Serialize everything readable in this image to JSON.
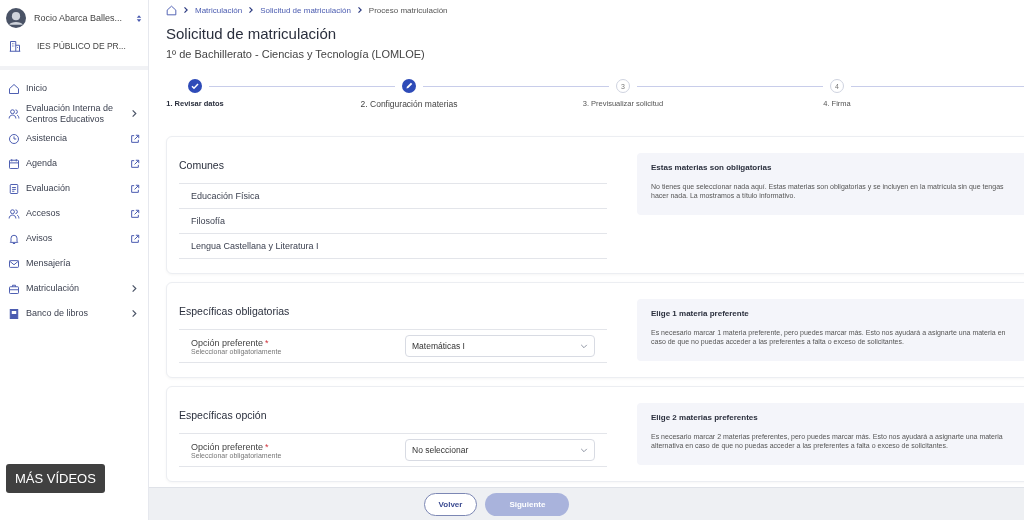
{
  "sidebar": {
    "user": {
      "name": "Rocio Abarca Balles..."
    },
    "school": {
      "name": "IES PÚBLICO DE PR..."
    },
    "items": [
      {
        "label": "Inicio",
        "kind": "link"
      },
      {
        "label": "Evaluación Interna de Centros Educativos",
        "kind": "submenu"
      },
      {
        "label": "Asistencia",
        "kind": "external"
      },
      {
        "label": "Agenda",
        "kind": "external"
      },
      {
        "label": "Evaluación",
        "kind": "external"
      },
      {
        "label": "Accesos",
        "kind": "external"
      },
      {
        "label": "Avisos",
        "kind": "external"
      },
      {
        "label": "Mensajería",
        "kind": "link"
      },
      {
        "label": "Matriculación",
        "kind": "submenu"
      },
      {
        "label": "Banco de libros",
        "kind": "submenu"
      }
    ]
  },
  "breadcrumb": [
    "Matriculación",
    "Solicitud de matriculación",
    "Proceso matriculación"
  ],
  "title": "Solicitud de matriculación",
  "subtitle": "1º de Bachillerato - Ciencias y Tecnología (LOMLOE)",
  "steps": [
    {
      "label": "1. Revisar datos",
      "kind": "done"
    },
    {
      "label": "2. Configuración materias",
      "kind": "current"
    },
    {
      "label": "3. Previsualizar solicitud",
      "kind": "pending",
      "number": "3"
    },
    {
      "label": "4. Firma",
      "kind": "pending",
      "number": "4"
    }
  ],
  "sections": [
    {
      "title": "Comunes",
      "kind": "list",
      "items": [
        "Educación Física",
        "Filosofía",
        "Lengua Castellana y Literatura I"
      ],
      "info_title": "Estas materias son obligatorias",
      "info_text": "No tienes que seleccionar nada aquí. Estas materias son obligatorias y se incluyen en la matrícula sin que tengas hacer nada. La mostramos a título informativo."
    },
    {
      "title": "Específicas obligatorias",
      "kind": "select",
      "field_label": "Opción preferente",
      "required_mark": "*",
      "field_hint": "Seleccionar obligatoriamente",
      "value": "Matemáticas I",
      "info_title": "Elige 1 materia preferente",
      "info_text": "Es necesario marcar 1 materia preferente, pero puedes marcar más. Esto nos ayudará a asignarte una materia en caso de que no puedas acceder a las preferentes a falta o exceso de solicitantes."
    },
    {
      "title": "Específicas opción",
      "kind": "select",
      "field_label": "Opción preferente",
      "required_mark": "*",
      "field_hint": "Seleccionar obligatoriamente",
      "value": "No seleccionar",
      "info_title": "Elige 2 materias preferentes",
      "info_text": "Es necesario marcar 2 materias preferentes, pero puedes marcar más. Esto nos ayudará a asignarte una materia alternativa en caso de que no puedas acceder a las preferentes a falta o exceso de solicitantes."
    }
  ],
  "footer": {
    "back": "Volver",
    "next": "Siguiente",
    "next_disabled": true
  },
  "video_overlay": "MÁS VÍDEOS"
}
